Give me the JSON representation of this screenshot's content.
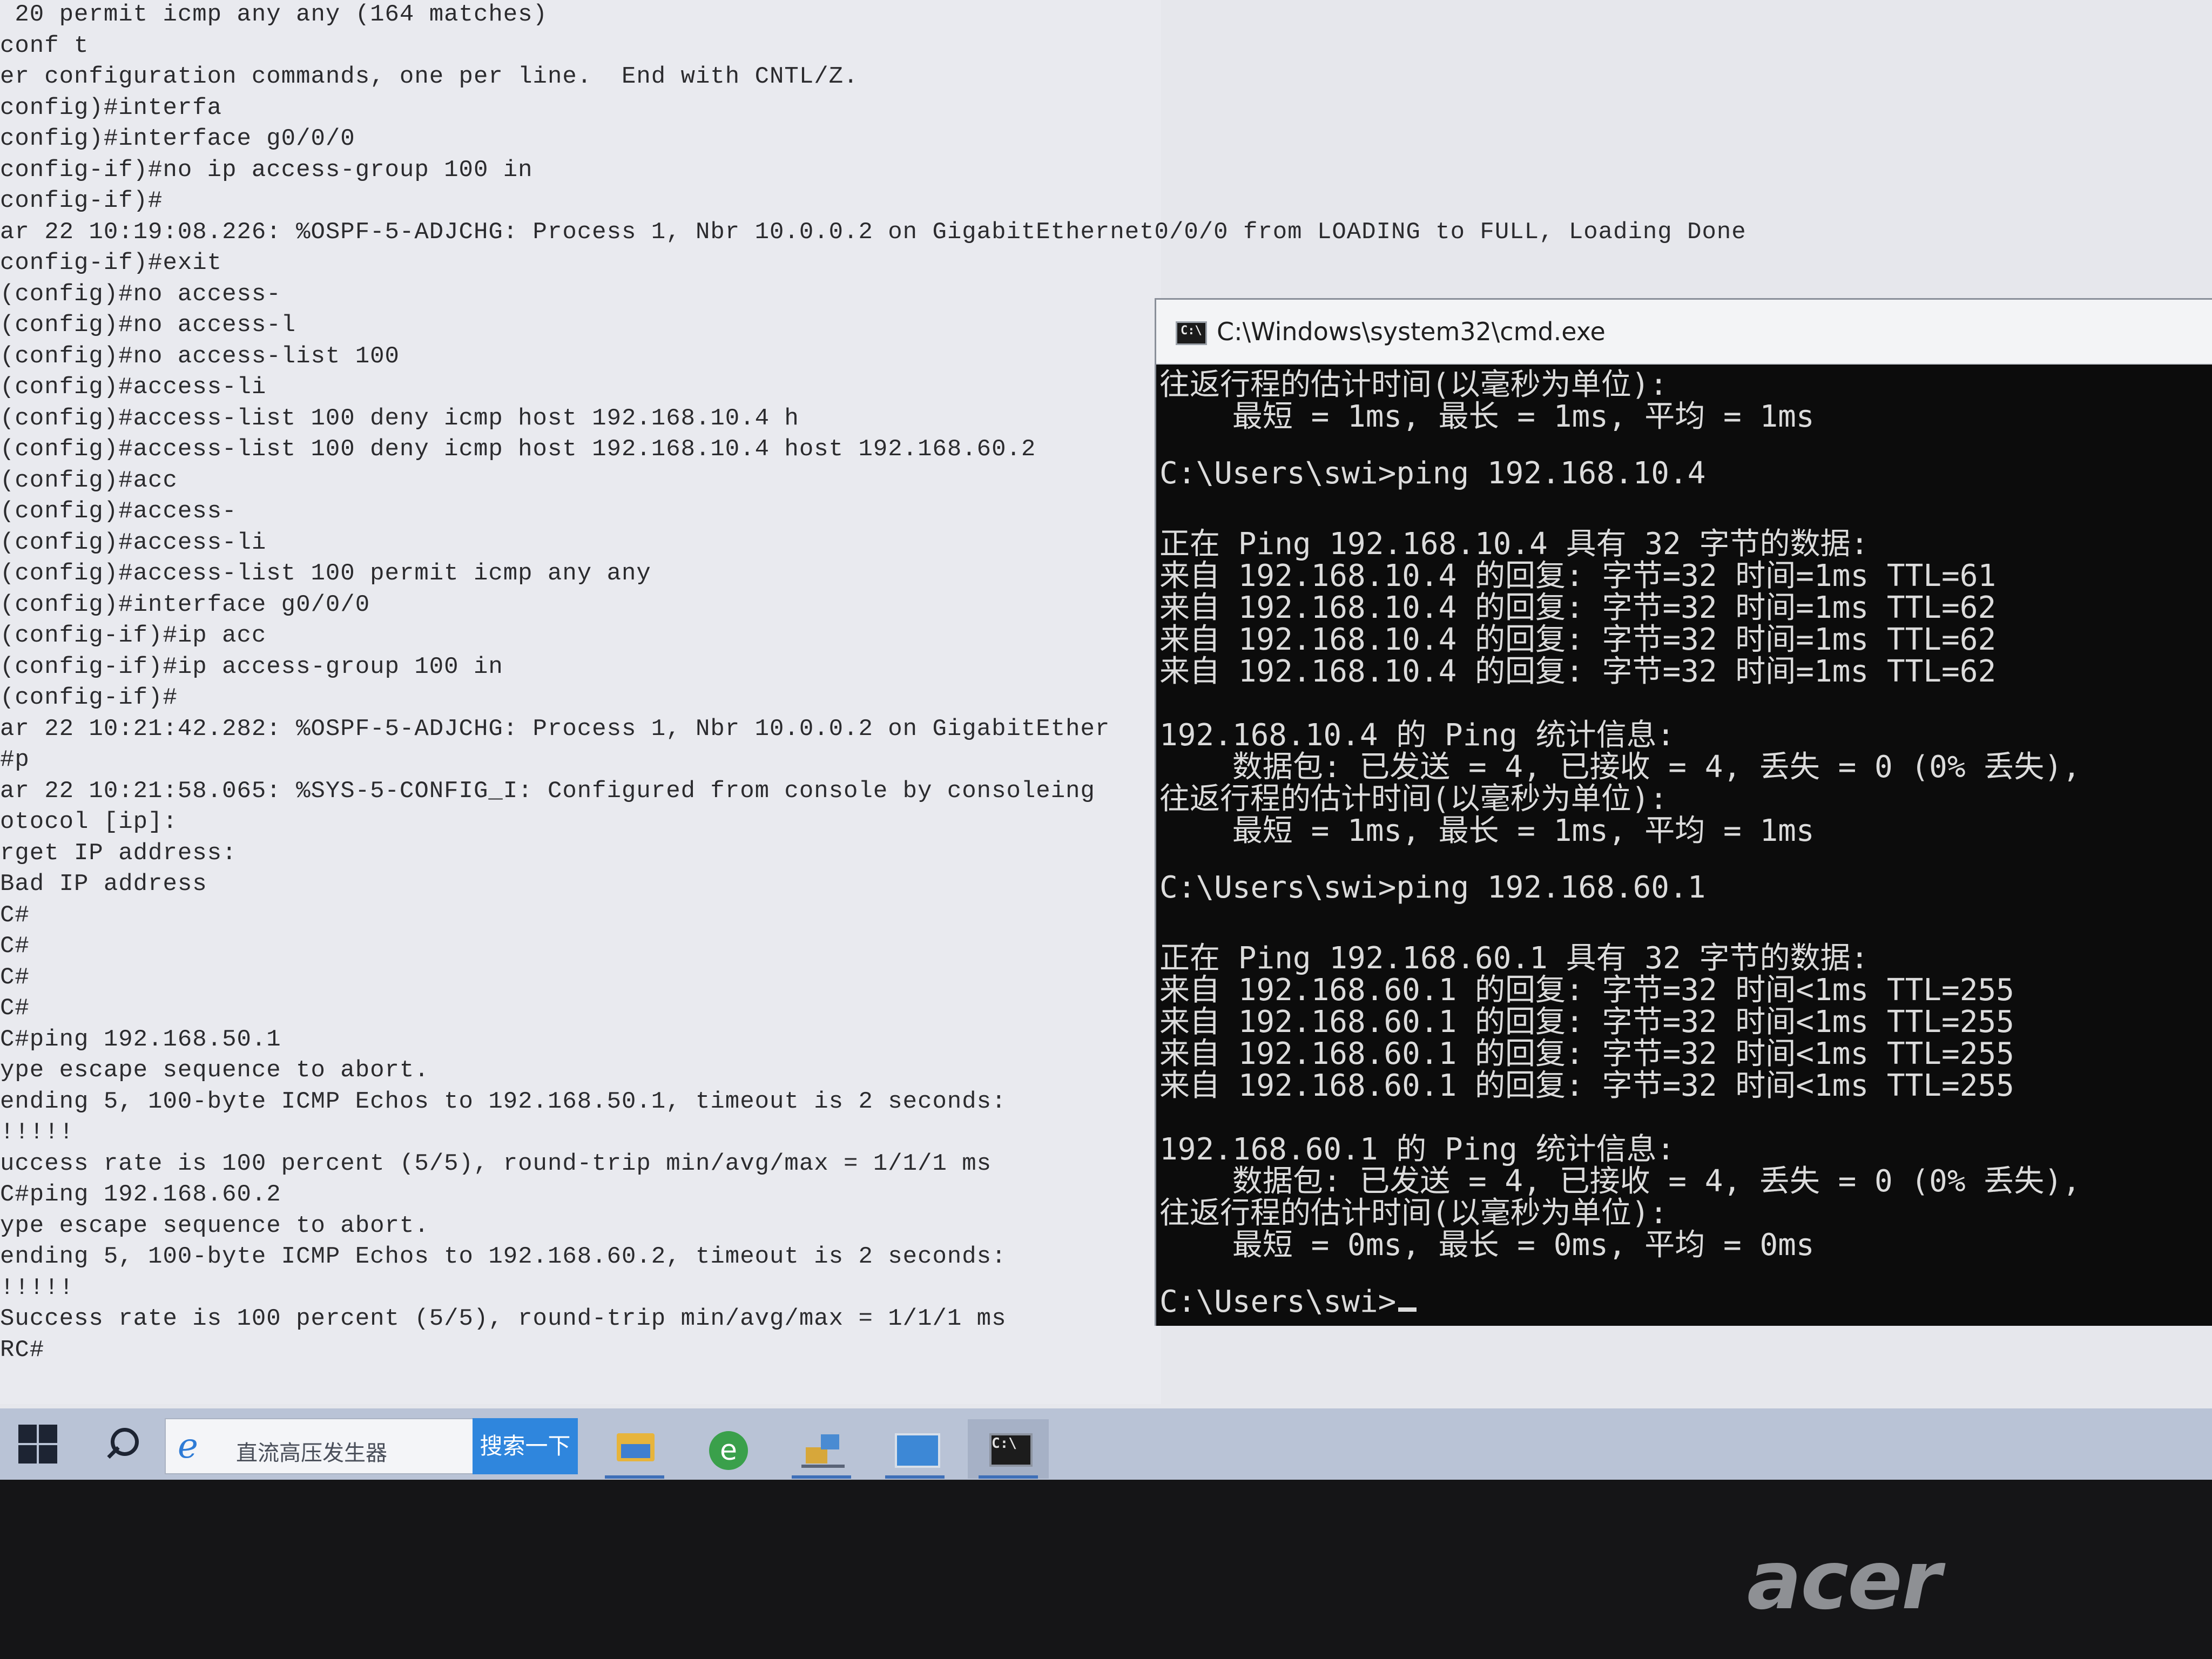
{
  "router_terminal": {
    "lines": [
      " 20 permit icmp any any (164 matches)",
      "conf t",
      "er configuration commands, one per line.  End with CNTL/Z.",
      "config)#interfa",
      "config)#interface g0/0/0",
      "config-if)#no ip access-group 100 in",
      "config-if)#",
      "ar 22 10:19:08.226: %OSPF-5-ADJCHG: Process 1, Nbr 10.0.0.2 on GigabitEthernet0/0/0 from LOADING to FULL, Loading Done",
      "config-if)#exit",
      "(config)#no access-",
      "(config)#no access-l",
      "(config)#no access-list 100",
      "(config)#access-li",
      "(config)#access-list 100 deny icmp host 192.168.10.4 h",
      "(config)#access-list 100 deny icmp host 192.168.10.4 host 192.168.60.2",
      "(config)#acc",
      "(config)#access-",
      "(config)#access-li",
      "(config)#access-list 100 permit icmp any any",
      "(config)#interface g0/0/0",
      "(config-if)#ip acc",
      "(config-if)#ip access-group 100 in",
      "(config-if)#",
      "ar 22 10:21:42.282: %OSPF-5-ADJCHG: Process 1, Nbr 10.0.0.2 on GigabitEther",
      "#p",
      "ar 22 10:21:58.065: %SYS-5-CONFIG_I: Configured from console by consoleing",
      "otocol [ip]:",
      "rget IP address:",
      "Bad IP address",
      "C#",
      "C#",
      "C#",
      "C#",
      "C#ping 192.168.50.1",
      "ype escape sequence to abort.",
      "ending 5, 100-byte ICMP Echos to 192.168.50.1, timeout is 2 seconds:",
      "!!!!!",
      "uccess rate is 100 percent (5/5), round-trip min/avg/max = 1/1/1 ms",
      "C#ping 192.168.60.2",
      "ype escape sequence to abort.",
      "ending 5, 100-byte ICMP Echos to 192.168.60.2, timeout is 2 seconds:",
      "!!!!!",
      "Success rate is 100 percent (5/5), round-trip min/avg/max = 1/1/1 ms",
      "RC#"
    ]
  },
  "cmd_window": {
    "title": "C:\\Windows\\system32\\cmd.exe",
    "icon": "cmd-icon",
    "lines": [
      "往返行程的估计时间(以毫秒为单位):",
      "    最短 = 1ms, 最长 = 1ms, 平均 = 1ms",
      "",
      "C:\\Users\\swi>ping 192.168.10.4",
      "",
      "正在 Ping 192.168.10.4 具有 32 字节的数据:",
      "来自 192.168.10.4 的回复: 字节=32 时间=1ms TTL=61",
      "来自 192.168.10.4 的回复: 字节=32 时间=1ms TTL=62",
      "来自 192.168.10.4 的回复: 字节=32 时间=1ms TTL=62",
      "来自 192.168.10.4 的回复: 字节=32 时间=1ms TTL=62",
      "",
      "192.168.10.4 的 Ping 统计信息:",
      "    数据包: 已发送 = 4, 已接收 = 4, 丢失 = 0 (0% 丢失),",
      "往返行程的估计时间(以毫秒为单位):",
      "    最短 = 1ms, 最长 = 1ms, 平均 = 1ms",
      "",
      "C:\\Users\\swi>ping 192.168.60.1",
      "",
      "正在 Ping 192.168.60.1 具有 32 字节的数据:",
      "来自 192.168.60.1 的回复: 字节=32 时间<1ms TTL=255",
      "来自 192.168.60.1 的回复: 字节=32 时间<1ms TTL=255",
      "来自 192.168.60.1 的回复: 字节=32 时间<1ms TTL=255",
      "来自 192.168.60.1 的回复: 字节=32 时间<1ms TTL=255",
      "",
      "192.168.60.1 的 Ping 统计信息:",
      "    数据包: 已发送 = 4, 已接收 = 4, 丢失 = 0 (0% 丢失),",
      "往返行程的估计时间(以毫秒为单位):",
      "    最短 = 0ms, 最长 = 0ms, 平均 = 0ms",
      "",
      "C:\\Users\\swi>"
    ]
  },
  "taskbar": {
    "search_placeholder": "直流高压发生器",
    "search_button": "搜索一下",
    "apps": [
      "file-explorer-icon",
      "browser-icon",
      "network-tool-icon",
      "monitor-app-icon",
      "terminal-icon"
    ]
  },
  "bezel": {
    "brand": "acer"
  }
}
